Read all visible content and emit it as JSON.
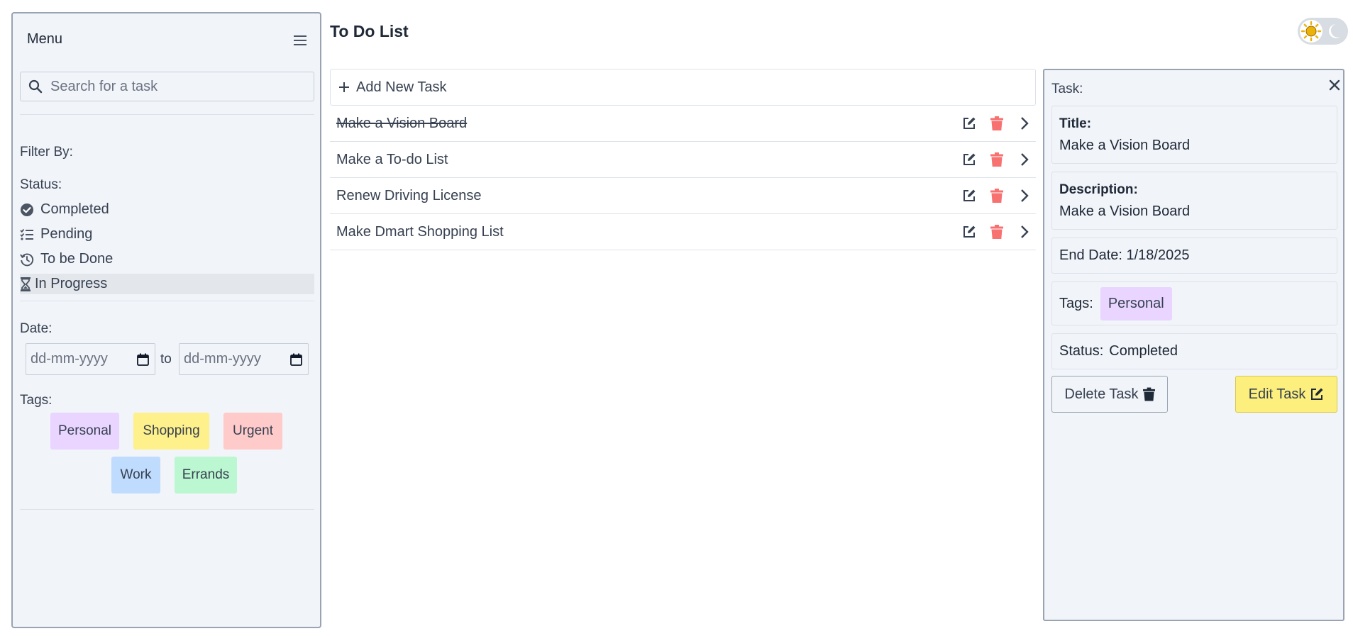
{
  "sidebar": {
    "menu_title": "Menu",
    "search_placeholder": "Search for a task",
    "filter_by": "Filter By:",
    "status_label": "Status:",
    "status_items": [
      {
        "label": "Completed",
        "icon": "check-circle-icon"
      },
      {
        "label": "Pending",
        "icon": "list-check-icon"
      },
      {
        "label": "To be Done",
        "icon": "history-icon"
      },
      {
        "label": "In Progress",
        "icon": "hourglass-icon",
        "active": true
      }
    ],
    "date_label": "Date:",
    "date_from_placeholder": "dd-mm-yyyy",
    "date_to_text": "to",
    "date_to_placeholder": "dd-mm-yyyy",
    "tags_label": "Tags:",
    "tags": [
      {
        "label": "Personal",
        "color": "#e9d5ff"
      },
      {
        "label": "Shopping",
        "color": "#fef08a"
      },
      {
        "label": "Urgent",
        "color": "#fecaca"
      },
      {
        "label": "Work",
        "color": "#bfdbfe"
      },
      {
        "label": "Errands",
        "color": "#bbf7d0"
      }
    ]
  },
  "header": {
    "title": "To Do List",
    "theme_toggle_icons": [
      "sun-icon",
      "moon-icon"
    ]
  },
  "task_list": {
    "add_label": "Add New Task",
    "tasks": [
      {
        "title": "Make a Vision Board",
        "completed": true
      },
      {
        "title": "Make a To-do List",
        "completed": false
      },
      {
        "title": "Renew Driving License",
        "completed": false
      },
      {
        "title": "Make Dmart Shopping List",
        "completed": false
      }
    ]
  },
  "detail": {
    "heading": "Task:",
    "title_label": "Title:",
    "title_value": "Make a Vision Board",
    "description_label": "Description:",
    "description_value": "Make a Vision Board",
    "end_date_text": "End Date: 1/18/2025",
    "tags_label": "Tags:",
    "tag_value": "Personal",
    "status_label": "Status:",
    "status_value": "Completed",
    "delete_label": "Delete Task",
    "edit_label": "Edit Task"
  },
  "colors": {
    "panel_bg": "#f1f4f9",
    "panel_border": "#9aa3b2",
    "delete_red": "#f87171",
    "edit_yellow": "#fcef7d",
    "sun_yellow": "#eab308"
  }
}
